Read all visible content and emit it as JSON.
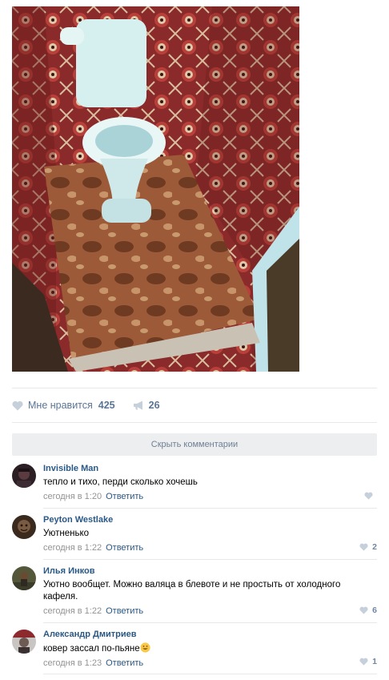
{
  "post": {
    "photo_icon": "photo-toilet-carpet",
    "likes": {
      "label": "Мне нравится",
      "count": "425",
      "icon": "heart-icon"
    },
    "shares": {
      "count": "26",
      "icon": "megaphone-icon"
    }
  },
  "comments_toggle": "Скрыть комментарии",
  "comments": [
    {
      "author": "Invisible Man",
      "text": "тепло и тихо, перди сколько хочешь",
      "time": "сегодня в 1:20",
      "reply": "Ответить",
      "likes": ""
    },
    {
      "author": "Peyton Westlake",
      "text": "Уютненько",
      "time": "сегодня в 1:22",
      "reply": "Ответить",
      "likes": "2"
    },
    {
      "author": "Илья Инков",
      "text": "Уютно вообщет. Можно валяца в блевоте и не простыть от холодного кафеля.",
      "time": "сегодня в 1:22",
      "reply": "Ответить",
      "likes": "6"
    },
    {
      "author": "Александр Дмитриев",
      "text": "ковер зассал по-пьяне",
      "time": "сегодня в 1:23",
      "reply": "Ответить",
      "likes": "1",
      "emoji": "smiley-icon"
    }
  ],
  "colors": {
    "link": "#2a5885",
    "muted": "#939393",
    "toggle_bg": "#edeef0"
  }
}
